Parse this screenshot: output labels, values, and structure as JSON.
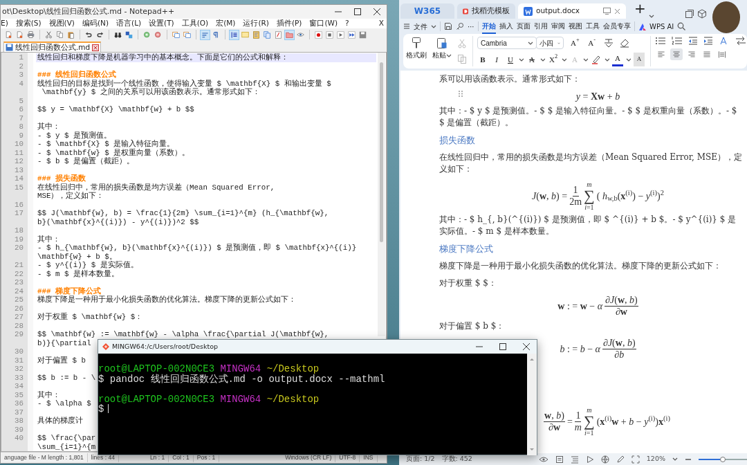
{
  "notepad": {
    "title": "ot\\Desktop\\线性回归函数公式.md - Notepad++",
    "menu": [
      "E)",
      "搜索(S)",
      "视图(V)",
      "编码(N)",
      "语言(L)",
      "设置(T)",
      "工具(O)",
      "宏(M)",
      "运行(R)",
      "插件(P)",
      "窗口(W)",
      "?"
    ],
    "menu_close": "X",
    "toolbar": [
      [
        {
          "kind": "document",
          "pressed": false
        },
        {
          "kind": "document",
          "pressed": false
        },
        {
          "kind": "printer",
          "pressed": false
        }
      ],
      [
        {
          "kind": "scissors",
          "pressed": false
        },
        {
          "kind": "copy",
          "pressed": false
        },
        {
          "kind": "paste",
          "pressed": false
        }
      ],
      [
        {
          "kind": "undo",
          "pressed": false
        },
        {
          "kind": "redo",
          "pressed": false
        }
      ],
      [
        {
          "kind": "binoculars",
          "pressed": false
        },
        {
          "kind": "replace",
          "pressed": false
        }
      ],
      [
        {
          "kind": "zoomin",
          "pressed": false
        },
        {
          "kind": "zoomout",
          "pressed": false
        }
      ],
      [
        {
          "kind": "window",
          "pressed": false
        },
        {
          "kind": "window",
          "pressed": false
        }
      ],
      [
        {
          "kind": "wrap",
          "pressed": true
        },
        {
          "kind": "pilcrow",
          "pressed": false
        }
      ],
      [
        {
          "kind": "indent",
          "pressed": true
        },
        {
          "kind": "panel",
          "pressed": false
        },
        {
          "kind": "map",
          "pressed": false
        },
        {
          "kind": "docs",
          "pressed": false
        },
        {
          "kind": "function",
          "pressed": false
        },
        {
          "kind": "folder",
          "pressed": true
        },
        {
          "kind": "eye",
          "pressed": false
        }
      ],
      [
        {
          "kind": "record",
          "pressed": false
        },
        {
          "kind": "stop",
          "pressed": false
        },
        {
          "kind": "play",
          "pressed": false
        },
        {
          "kind": "ffwd",
          "pressed": false
        },
        {
          "kind": "savemacro",
          "pressed": false
        }
      ]
    ],
    "tabs": [
      {
        "label": "线性回归函数公式.md",
        "selected": true
      }
    ],
    "lines": [
      {
        "number": "1",
        "current": true,
        "kind": "text",
        "rows": [
          "线性回归和梯度下降是机器学习中的基本概念。下面是它们的公式和解释："
        ]
      },
      {
        "number": "2",
        "current": false
      },
      {
        "number": "3",
        "current": false,
        "kind": "heading",
        "rows": [
          "### 线性回归函数公式"
        ]
      },
      {
        "number": "4",
        "current": false,
        "kind": "text",
        "rows": [
          "线性回归的目标是找到一个线性函数，使得输入变量 $ \\mathbf{X} $ 和输出变量 $",
          " \\mathbf{y} $ 之间的关系可以用该函数表示。通常形式如下："
        ]
      },
      {
        "number": "5",
        "current": false
      },
      {
        "number": "6",
        "current": false,
        "kind": "text",
        "rows": [
          "$$ y = \\mathbf{X} \\mathbf{w} + b $$"
        ]
      },
      {
        "number": "7",
        "current": false
      },
      {
        "number": "8",
        "current": false,
        "kind": "text",
        "rows": [
          "其中："
        ]
      },
      {
        "number": "9",
        "current": false,
        "kind": "text",
        "rows": [
          "- $ y $ 是预测值。"
        ]
      },
      {
        "number": "10",
        "current": false,
        "kind": "text",
        "rows": [
          "- $ \\mathbf{X} $ 是输入特征向量。"
        ]
      },
      {
        "number": "11",
        "current": false,
        "kind": "text",
        "rows": [
          "- $ \\mathbf{w} $ 是权重向量（系数）。"
        ]
      },
      {
        "number": "12",
        "current": false,
        "kind": "text",
        "rows": [
          "- $ b $ 是偏置（截距）。"
        ]
      },
      {
        "number": "13",
        "current": false
      },
      {
        "number": "14",
        "current": false,
        "kind": "heading",
        "rows": [
          "### 损失函数"
        ]
      },
      {
        "number": "15",
        "current": false,
        "kind": "text",
        "rows": [
          "在线性回归中，常用的损失函数是均方误差（Mean Squared Error,",
          "MSE），定义如下："
        ]
      },
      {
        "number": "16",
        "current": false
      },
      {
        "number": "17",
        "current": false,
        "kind": "text",
        "rows": [
          "$$ J(\\mathbf{w}, b) = \\frac{1}{2m} \\sum_{i=1}^{m} (h_{\\mathbf{w},",
          "b}(\\mathbf{x}^{(i)}) - y^{(i)})^2 $$"
        ]
      },
      {
        "number": "18",
        "current": false
      },
      {
        "number": "19",
        "current": false,
        "kind": "text",
        "rows": [
          "其中："
        ]
      },
      {
        "number": "20",
        "current": false,
        "kind": "text",
        "rows": [
          "- $ h_{\\mathbf{w}, b}(\\mathbf{x}^{(i)}) $ 是预测值，即 $ \\mathbf{x}^{(i)}",
          "\\mathbf{w} + b $。"
        ]
      },
      {
        "number": "21",
        "current": false,
        "kind": "text",
        "rows": [
          "- $ y^{(i)} $ 是实际值。"
        ]
      },
      {
        "number": "22",
        "current": false,
        "kind": "text",
        "rows": [
          "- $ m $ 是样本数量。"
        ]
      },
      {
        "number": "23",
        "current": false
      },
      {
        "number": "24",
        "current": false,
        "kind": "heading",
        "rows": [
          "### 梯度下降公式"
        ]
      },
      {
        "number": "25",
        "current": false,
        "kind": "text",
        "rows": [
          "梯度下降是一种用于最小化损失函数的优化算法。梯度下降的更新公式如下："
        ]
      },
      {
        "number": "26",
        "current": false
      },
      {
        "number": "27",
        "current": false,
        "kind": "text",
        "rows": [
          "对于权重 $ \\mathbf{w} $："
        ]
      },
      {
        "number": "28",
        "current": false
      },
      {
        "number": "29",
        "current": false,
        "kind": "text",
        "rows": [
          "$$ \\mathbf{w} := \\mathbf{w} - \\alpha \\frac{\\partial J(\\mathbf{w},",
          "b)}{\\partial"
        ]
      },
      {
        "number": "30",
        "current": false
      },
      {
        "number": "31",
        "current": false,
        "kind": "text",
        "rows": [
          "对于偏置 $ b"
        ]
      },
      {
        "number": "32",
        "current": false
      },
      {
        "number": "33",
        "current": false,
        "kind": "text",
        "rows": [
          "$$ b := b - \\"
        ]
      },
      {
        "number": "34",
        "current": false
      },
      {
        "number": "35",
        "current": false,
        "kind": "text",
        "rows": [
          "其中："
        ]
      },
      {
        "number": "36",
        "current": false,
        "kind": "text",
        "rows": [
          "- $ \\alpha $"
        ]
      },
      {
        "number": "37",
        "current": false
      },
      {
        "number": "38",
        "current": false,
        "kind": "text",
        "rows": [
          "具体的梯度计"
        ]
      },
      {
        "number": "39",
        "current": false
      },
      {
        "number": "40",
        "current": false,
        "kind": "text",
        "rows": [
          "$$ \\frac{\\par",
          "\\sum_{i=1}^{m"
        ]
      }
    ],
    "status": [
      "anguage file - M length : 1,801",
      "lines : 44",
      "Ln : 1",
      "Col : 1",
      "Pos : 1",
      "Windows (CR LF)",
      "UTF-8",
      "INS"
    ]
  },
  "terminal": {
    "title": "MINGW64:/c/Users/root/Desktop",
    "lines": [
      {
        "kind": "prompt",
        "user": "root@LAPTOP-002N0CE3",
        "system": "MINGW64",
        "path": "~/Desktop"
      },
      {
        "kind": "command",
        "text": "$ pandoc 线性回归函数公式.md -o output.docx --mathml"
      },
      {
        "kind": "blank"
      },
      {
        "kind": "prompt",
        "user": "root@LAPTOP-002N0CE3",
        "system": "MINGW64",
        "path": "~/Desktop"
      },
      {
        "kind": "input",
        "text": "$"
      }
    ]
  },
  "wps": {
    "tabs": [
      {
        "kind": "home",
        "label": "W365",
        "selected": false
      },
      {
        "kind": "template",
        "label": "找稻壳模板",
        "selected": false
      },
      {
        "kind": "document",
        "label": "output.docx",
        "selected": true
      }
    ],
    "new_tab": "+",
    "menu": {
      "file": "文件",
      "more": "⋯",
      "ai": "WPS AI",
      "tabs": [
        {
          "label": "开始",
          "selected": true
        },
        {
          "label": "插入",
          "selected": false
        },
        {
          "label": "页面",
          "selected": false
        },
        {
          "label": "引用",
          "selected": false
        },
        {
          "label": "审阅",
          "selected": false
        },
        {
          "label": "视图",
          "selected": false
        },
        {
          "label": "工具",
          "selected": false
        },
        {
          "label": "会员专享",
          "selected": false
        }
      ]
    },
    "ribbon": {
      "format_painter": "格式刷",
      "paste": "粘贴",
      "font": "Cambria",
      "size": "小四",
      "size_buttons": [
        "A$^{+}$",
        "A$^{-}$"
      ],
      "format_buttons": [
        {
          "kind": "bold",
          "label": "B"
        },
        {
          "kind": "italic",
          "label": "I"
        },
        {
          "kind": "underline",
          "label": "U"
        },
        {
          "kind": "strike",
          "label": "A"
        },
        {
          "kind": "superscript",
          "label": "X$^{2}$"
        },
        {
          "kind": "effect",
          "label": "A"
        },
        {
          "kind": "highlight"
        },
        {
          "kind": "color",
          "label": "A"
        },
        {
          "kind": "shading",
          "label": "A"
        }
      ],
      "align_buttons": [
        {
          "kind": "left",
          "selected": false
        },
        {
          "kind": "center",
          "selected": true
        },
        {
          "kind": "right",
          "selected": false
        },
        {
          "kind": "justify",
          "selected": false
        },
        {
          "kind": "distributed",
          "selected": false
        }
      ]
    },
    "document": [
      {
        "kind": "text",
        "handle": false,
        "text": "系可以用该函数表示。通常形式如下："
      },
      {
        "kind": "formula",
        "handle": true,
        "parts": [
          {
            "kind": "text",
            "text": "*y* = **Xw** + *b*"
          }
        ]
      },
      {
        "kind": "text",
        "handle": false,
        "text": "其中：- $ y $ 是预测值。- $ $ 是输入特征向量。- $ $ 是权重向量（系数）。- $ $ 是偏置（截距）。"
      },
      {
        "kind": "heading",
        "handle": false,
        "text": "损失函数"
      },
      {
        "kind": "text",
        "handle": false,
        "text": "在线性回归中，常用的损失函数是均方误差（Mean Squared Error, MSE），定义如下："
      },
      {
        "kind": "formula",
        "handle": false,
        "parts": [
          {
            "kind": "text",
            "text": "*J*(**w**, *b*) ="
          },
          {
            "kind": "frac",
            "num": "1",
            "den": "2m"
          },
          {
            "kind": "sum",
            "symbol": "∑",
            "upper": "*m*",
            "lower": "*i*=1"
          },
          {
            "kind": "text",
            "text": "( *h*$_{w,b}$(**x**$^{(i)}$) − *y*$^{(i)}$)$^{2}$"
          }
        ]
      },
      {
        "kind": "text",
        "handle": false,
        "text": "其中：- $ h_{, b}(^{(i)}) $ 是预测值，即 $ ^{(i)} + b $。- $ y^{(i)} $ 是实际值。- $ m $ 是样本数量。"
      },
      {
        "kind": "heading",
        "handle": false,
        "text": "梯度下降公式"
      },
      {
        "kind": "text",
        "handle": false,
        "text": "梯度下降是一种用于最小化损失函数的优化算法。梯度下降的更新公式如下："
      },
      {
        "kind": "text",
        "handle": false,
        "text": "对于权重 $ $："
      },
      {
        "kind": "formula",
        "handle": false,
        "parts": [
          {
            "kind": "text",
            "text": "**w** : = **w** − *α*"
          },
          {
            "kind": "frac",
            "num": "∂*J*(**w**, *b*)",
            "den": "∂**w**"
          }
        ]
      },
      {
        "kind": "text",
        "handle": false,
        "text": "对于偏置 $ b $："
      },
      {
        "kind": "formula",
        "handle": false,
        "parts": [
          {
            "kind": "text",
            "text": "*b* : = *b* − *α*"
          },
          {
            "kind": "frac",
            "num": "∂*J*(**w**, *b*)",
            "den": "∂*b*"
          }
        ]
      },
      {
        "kind": "formula",
        "handle": false,
        "parts": [
          {
            "kind": "frac",
            "num": "**w**, *b*)",
            "den": "∂**w**"
          },
          {
            "kind": "text",
            "text": "="
          },
          {
            "kind": "frac",
            "num": "1",
            "den": "*m*"
          },
          {
            "kind": "sum",
            "symbol": "∑",
            "upper": "*m*",
            "lower": "*i*=1"
          },
          {
            "kind": "text",
            "text": "(**x**$^{(i)}$**w** + *b* − *y*$^{(i)}$)**x**$^{(i)}$"
          }
        ]
      }
    ],
    "status": {
      "page": "页面: 1/2",
      "words": "字数: 452",
      "zoom": "120%",
      "zoom_slider": {
        "level": 0.5
      }
    }
  }
}
